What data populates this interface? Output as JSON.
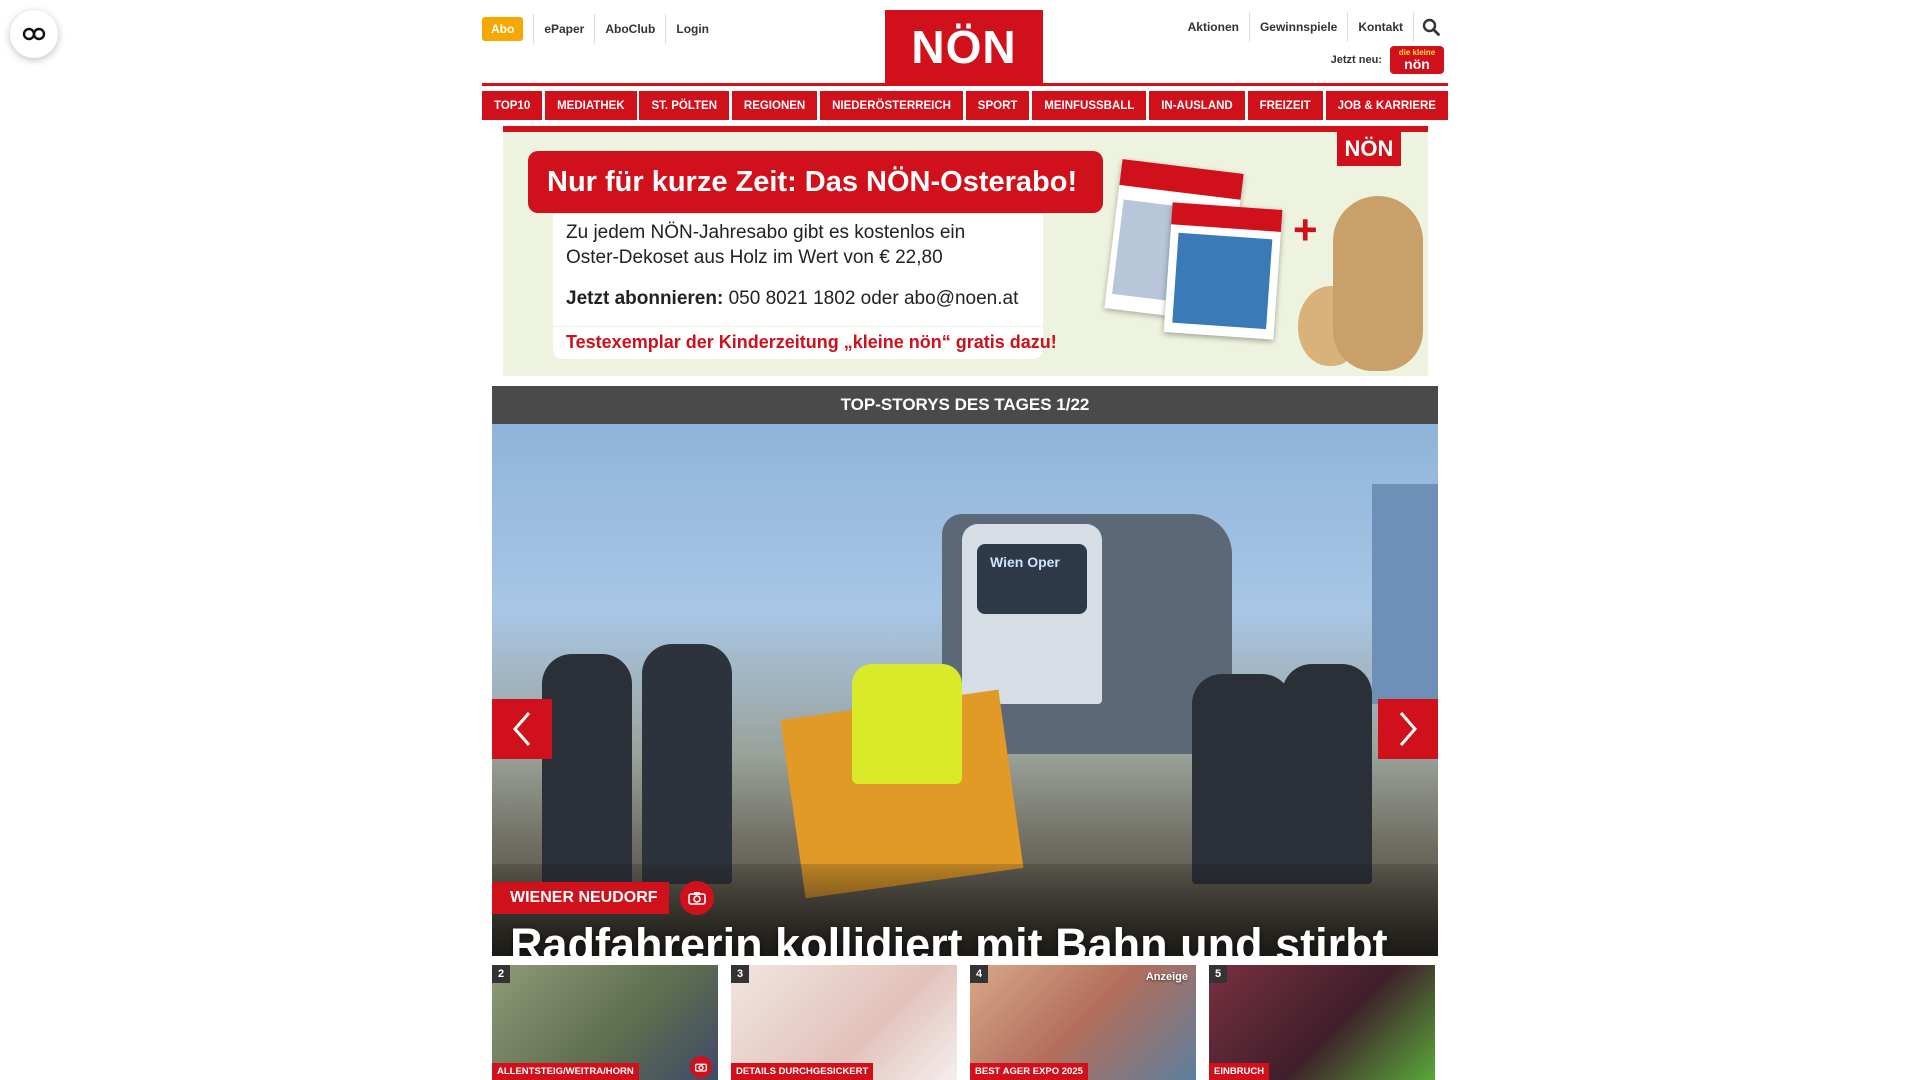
{
  "header": {
    "abo_label": "Abo",
    "top_links": [
      "ePaper",
      "AboClub",
      "Login"
    ],
    "logo": "NÖN",
    "right_links": [
      "Aktionen",
      "Gewinnspiele",
      "Kontakt"
    ],
    "jetzt_neu": "Jetzt neu:",
    "kleine_logo_top": "die kleine",
    "kleine_logo_bottom": "nön"
  },
  "nav": [
    "TOP10",
    "MEDIATHEK",
    "ST. PÖLTEN",
    "REGIONEN",
    "NIEDERÖSTERREICH",
    "SPORT",
    "MEINFUSSBALL",
    "IN-AUSLAND",
    "FREIZEIT",
    "JOB & KARRIERE"
  ],
  "banner": {
    "headline": "Nur für kurze Zeit: Das NÖN-Osterabo!",
    "line1": "Zu jedem NÖN-Jahresabo gibt es kostenlos ein",
    "line2": "Oster-Dekoset aus Holz im Wert von € 22,80",
    "line3_bold": "Jetzt abonnieren:",
    "line3_rest": " 050 8021 1802 oder abo@noen.at",
    "tagline": "Testexemplar der Kinderzeitung „kleine nön“ gratis dazu!",
    "brand": "NÖN",
    "plus": "+"
  },
  "carousel": {
    "title": "TOP-STORYS DES TAGES 1/22",
    "tag": "WIENER NEUDORF",
    "headline": "Radfahrerin kollidiert mit Bahn und stirbt",
    "tram_sign": "Wien Oper"
  },
  "thumbs": [
    {
      "num": "2",
      "tag": "ALLENTSTEIG/WEITRA/HORN",
      "anzeige": "",
      "color": "#7e8a6a"
    },
    {
      "num": "3",
      "tag": "DETAILS DURCHGESICKERT",
      "anzeige": "",
      "color": "#e9d9d4"
    },
    {
      "num": "4",
      "tag": "BEST AGER EXPO 2025",
      "anzeige": "Anzeige",
      "color": "#c48a73"
    },
    {
      "num": "5",
      "tag": "EINBRUCH",
      "anzeige": "",
      "color": "#5e2a3a"
    }
  ]
}
